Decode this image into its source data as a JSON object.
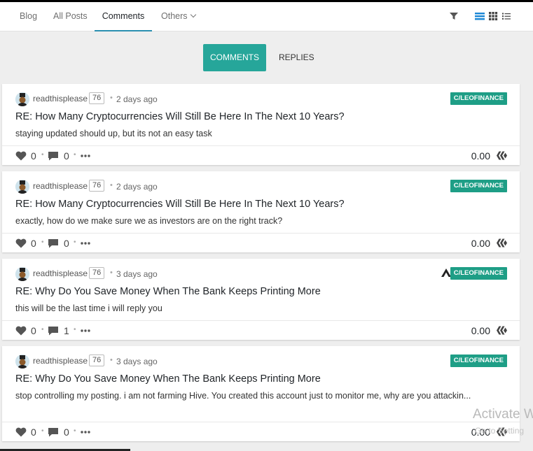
{
  "nav": {
    "blog": "Blog",
    "all_posts": "All Posts",
    "comments": "Comments",
    "others": "Others"
  },
  "tools": {
    "filter_icon": "filter-icon",
    "view_icons": [
      "view-list-icon",
      "view-grid-icon",
      "view-compact-icon"
    ]
  },
  "tabs": {
    "comments": "COMMENTS",
    "replies": "REPLIES"
  },
  "colors": {
    "accent": "#26a69a",
    "community_badge": "#1e9e86",
    "active_underline": "#2a8fb0"
  },
  "comments": [
    {
      "author": "readthisplease",
      "reputation": "76",
      "time": "2 days ago",
      "community": "C/LEOFINANCE",
      "title": "RE: How Many Cryptocurrencies Will Still Be Here In The Next 10 Years?",
      "snippet": "staying updated should up, but its not an easy task",
      "votes": "0",
      "replies": "0",
      "payout": "0.00"
    },
    {
      "author": "readthisplease",
      "reputation": "76",
      "time": "2 days ago",
      "community": "C/LEOFINANCE",
      "title": "RE: How Many Cryptocurrencies Will Still Be Here In The Next 10 Years?",
      "snippet": "exactly, how do we make sure we as investors are on the right track?",
      "votes": "0",
      "replies": "0",
      "payout": "0.00"
    },
    {
      "author": "readthisplease",
      "reputation": "76",
      "time": "3 days ago",
      "community": "C/LEOFINANCE",
      "title": "RE: Why Do You Save Money When The Bank Keeps Printing More",
      "snippet": "this will be the last time i will reply you",
      "votes": "0",
      "replies": "1",
      "payout": "0.00"
    },
    {
      "author": "readthisplease",
      "reputation": "76",
      "time": "3 days ago",
      "community": "C/LEOFINANCE",
      "title": "RE: Why Do You Save Money When The Bank Keeps Printing More",
      "snippet": "stop controlling my posting. i am not farming Hive. You created this account just to monitor me, why are you attackin...",
      "votes": "0",
      "replies": "0",
      "payout": "0.00"
    }
  ],
  "watermark": {
    "title": "Activate W",
    "subtitle": "Go to Setting"
  }
}
